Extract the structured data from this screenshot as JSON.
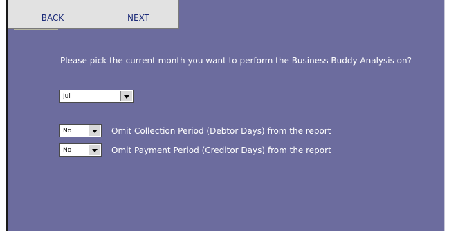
{
  "nav": {
    "back_label": "BACK",
    "next_label": "NEXT"
  },
  "main": {
    "question": "Please pick the current month you want to perform the Business Buddy Analysis on?",
    "month_select": {
      "value": "Jul"
    },
    "options": [
      {
        "value": "No",
        "label": "Omit Collection Period (Debtor Days) from the report"
      },
      {
        "value": "No",
        "label": "Omit Payment Period (Creditor Days) from the report"
      }
    ]
  },
  "colors": {
    "panel_bg": "#6c6c9e",
    "tab_bg": "#e2e2e2",
    "tab_text": "#1b2a78",
    "body_text": "#ffffff"
  },
  "icons": [
    "dropdown-arrow-icon"
  ]
}
